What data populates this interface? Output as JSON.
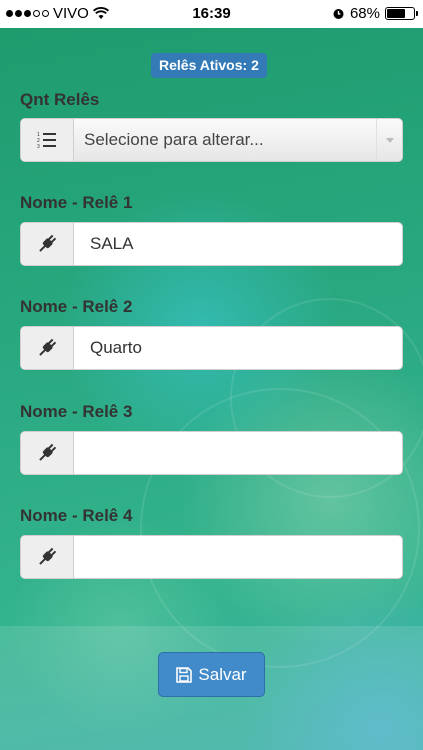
{
  "status_bar": {
    "carrier": "VIVO",
    "time": "16:39",
    "battery": "68%",
    "battery_level": 0.68,
    "signal_bars_filled": 3,
    "signal_bars_total": 5
  },
  "badge": {
    "text": "Relês Ativos: 2"
  },
  "qnt": {
    "label": "Qnt Relês",
    "select_value": "Selecione para alterar...",
    "icon": "ordered-list-icon"
  },
  "relays": [
    {
      "label": "Nome - Relê 1",
      "value": "SALA",
      "icon": "plug-icon"
    },
    {
      "label": "Nome - Relê 2",
      "value": "Quarto",
      "icon": "plug-icon"
    },
    {
      "label": "Nome - Relê 3",
      "value": "",
      "icon": "plug-icon"
    },
    {
      "label": "Nome - Relê 4",
      "value": "",
      "icon": "plug-icon"
    }
  ],
  "save_button": {
    "label": "Salvar",
    "icon": "floppy-icon"
  },
  "colors": {
    "badge": "#337ab7",
    "button": "#428bca",
    "background": "#2aa57a"
  }
}
